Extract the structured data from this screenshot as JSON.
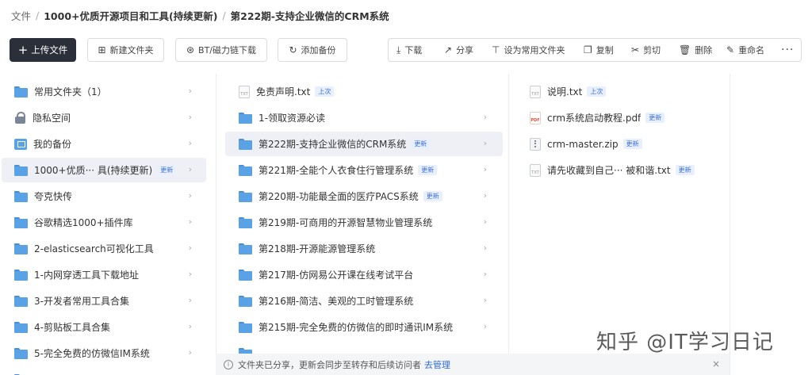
{
  "breadcrumb": {
    "root": "文件",
    "level1": "1000+优质开源项目和工具(持续更新)",
    "current": "第222期-支持企业微信的CRM系统"
  },
  "toolbar": {
    "upload": "上传文件",
    "new_folder": "新建文件夹",
    "bt_download": "BT/磁力链下载",
    "add_backup": "添加备份",
    "actions": {
      "download": "下载",
      "share": "分享",
      "set_common": "设为常用文件夹",
      "copy": "复制",
      "cut": "剪切",
      "delete": "删除",
      "rename": "重命名",
      "more": "···"
    }
  },
  "sidebar": {
    "items": [
      {
        "label": "常用文件夹（1）",
        "icon": "folder-icon"
      },
      {
        "label": "隐私空间",
        "icon": "lock-icon"
      },
      {
        "label": "我的备份",
        "icon": "backup-icon"
      },
      {
        "label": "1000+优质··· 具(持续更新)",
        "icon": "folder-icon",
        "tag": "更新"
      },
      {
        "label": "夸克快传",
        "icon": "folder-icon"
      },
      {
        "label": "谷歌精选1000+插件库",
        "icon": "folder-icon"
      },
      {
        "label": "2-elasticsearch可视化工具",
        "icon": "folder-icon"
      },
      {
        "label": "1-内网穿透工具下载地址",
        "icon": "folder-icon"
      },
      {
        "label": "3-开发者常用工具合集",
        "icon": "folder-icon"
      },
      {
        "label": "4-剪贴板工具合集",
        "icon": "folder-icon"
      },
      {
        "label": "5-完全免费的仿微信IM系统",
        "icon": "folder-icon"
      }
    ]
  },
  "middle": {
    "items": [
      {
        "label": "免责声明.txt",
        "tag": "上次"
      },
      {
        "label": "1-领取资源必读"
      },
      {
        "label": "第222期-支持企业微信的CRM系统",
        "tag": "更新"
      },
      {
        "label": "第221期-全能个人衣食住行管理系统",
        "tag": "更新"
      },
      {
        "label": "第220期-功能最全面的医疗PACS系统",
        "tag": "更新"
      },
      {
        "label": "第219期-可商用的开源智慧物业管理系统"
      },
      {
        "label": "第218期-开源能源管理系统"
      },
      {
        "label": "第217期-仿网易公开课在线考试平台"
      },
      {
        "label": "第216期-简洁、美观的工时管理系统"
      },
      {
        "label": "第215期-完全免费的仿微信的即时通讯IM系统"
      }
    ]
  },
  "right": {
    "items": [
      {
        "label": "说明.txt",
        "tag": "上次"
      },
      {
        "label": "crm系统启动教程.pdf",
        "tag": "更新"
      },
      {
        "label": "crm-master.zip",
        "tag": "更新"
      },
      {
        "label": "请先收藏到自己··· 被和谐.txt",
        "tag": "更新"
      }
    ]
  },
  "notice": {
    "text": "文件夹已分享，更新会同步至转存和后续访问者",
    "link": "去管理",
    "close": "×"
  },
  "watermark": "知乎 @IT学习日记"
}
